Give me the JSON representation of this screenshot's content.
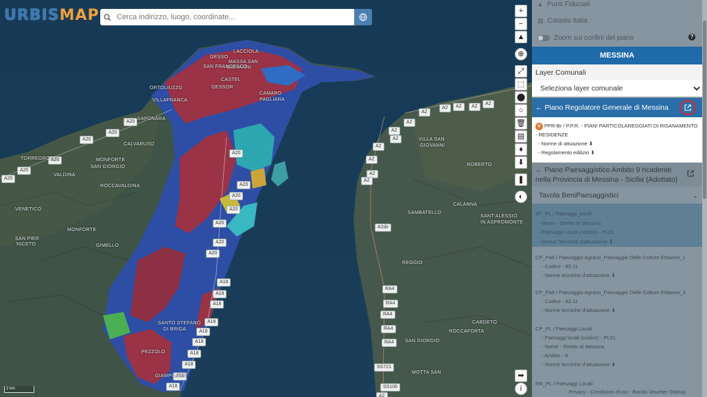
{
  "app": {
    "logo_part1": "URBIS",
    "logo_part2": "MAP"
  },
  "search": {
    "placeholder": "Cerca indirizzo, luogo, coordinate..."
  },
  "map": {
    "scale_label": "2 km",
    "road_badges": [
      {
        "label": "A20",
        "l": 180,
        "t": 172
      },
      {
        "label": "A20",
        "l": 154,
        "t": 188
      },
      {
        "label": "A20",
        "l": 116,
        "t": 198
      },
      {
        "label": "A20",
        "l": 70,
        "t": 228
      },
      {
        "label": "A20",
        "l": 25,
        "t": 243
      },
      {
        "label": "A20",
        "l": 2,
        "t": 255
      },
      {
        "label": "A20",
        "l": 334,
        "t": 218
      },
      {
        "label": "A20",
        "l": 345,
        "t": 264
      },
      {
        "label": "A20",
        "l": 334,
        "t": 280
      },
      {
        "label": "A20",
        "l": 330,
        "t": 300
      },
      {
        "label": "A20",
        "l": 310,
        "t": 320
      },
      {
        "label": "A20",
        "l": 310,
        "t": 348
      },
      {
        "label": "A20",
        "l": 300,
        "t": 364
      },
      {
        "label": "A18",
        "l": 316,
        "t": 406
      },
      {
        "label": "A18",
        "l": 310,
        "t": 423
      },
      {
        "label": "A18",
        "l": 306,
        "t": 438
      },
      {
        "label": "A18",
        "l": 298,
        "t": 464
      },
      {
        "label": "A18",
        "l": 286,
        "t": 478
      },
      {
        "label": "A18",
        "l": 280,
        "t": 493
      },
      {
        "label": "A18",
        "l": 273,
        "t": 510
      },
      {
        "label": "A18",
        "l": 265,
        "t": 526
      },
      {
        "label": "A18",
        "l": 252,
        "t": 543
      },
      {
        "label": "A18",
        "l": 242,
        "t": 558
      },
      {
        "label": "A2",
        "l": 640,
        "t": 152
      },
      {
        "label": "A2",
        "l": 660,
        "t": 150
      },
      {
        "label": "A2",
        "l": 683,
        "t": 150
      },
      {
        "label": "A2",
        "l": 703,
        "t": 146
      },
      {
        "label": "A2",
        "l": 610,
        "t": 158
      },
      {
        "label": "A2",
        "l": 588,
        "t": 173
      },
      {
        "label": "A2",
        "l": 566,
        "t": 185
      },
      {
        "label": "A2",
        "l": 568,
        "t": 197
      },
      {
        "label": "A2",
        "l": 543,
        "t": 208
      },
      {
        "label": "A2",
        "l": 533,
        "t": 227
      },
      {
        "label": "A2",
        "l": 534,
        "t": 248
      },
      {
        "label": "A2",
        "l": 526,
        "t": 258
      },
      {
        "label": "A2dir",
        "l": 546,
        "t": 326
      },
      {
        "label": "RA4",
        "l": 557,
        "t": 416
      },
      {
        "label": "RA4",
        "l": 558,
        "t": 437
      },
      {
        "label": "RA4",
        "l": 554,
        "t": 453
      },
      {
        "label": "RA4",
        "l": 555,
        "t": 474
      },
      {
        "label": "RA4",
        "l": 556,
        "t": 494
      },
      {
        "label": "SS721",
        "l": 545,
        "t": 530
      },
      {
        "label": "SS106",
        "l": 554,
        "t": 559
      },
      {
        "label": "A2",
        "l": 548,
        "t": 572
      }
    ],
    "place_labels": [
      {
        "label": "MASSA SAN",
        "l": 333,
        "t": 87
      },
      {
        "label": "GIOVANNI",
        "l": 330,
        "t": 95
      },
      {
        "label": "CASTEL",
        "l": 322,
        "t": 113
      },
      {
        "label": "LACCIOLA",
        "l": 340,
        "t": 72
      },
      {
        "label": "GESSO",
        "l": 306,
        "t": 80
      },
      {
        "label": "GESSOR",
        "l": 308,
        "t": 124
      },
      {
        "label": "CAMARO",
        "l": 378,
        "t": 133
      },
      {
        "label": "PAGLIARA",
        "l": 378,
        "t": 142
      },
      {
        "label": "SAN FRANCESCO",
        "l": 296,
        "t": 94
      },
      {
        "label": "ORTOLIUZZO",
        "l": 218,
        "t": 125
      },
      {
        "label": "VILLAFRANCA",
        "l": 222,
        "t": 143
      },
      {
        "label": "SAPONARA",
        "l": 200,
        "t": 170
      },
      {
        "label": "CALVARUSO",
        "l": 180,
        "t": 207
      },
      {
        "label": "MONFORTE",
        "l": 140,
        "t": 230
      },
      {
        "label": "SAN GIORGIO",
        "l": 132,
        "t": 240
      },
      {
        "label": "ROCCAVALDINA",
        "l": 146,
        "t": 268
      },
      {
        "label": "TORREGROTTA",
        "l": 30,
        "t": 228
      },
      {
        "label": "VALDINA",
        "l": 78,
        "t": 252
      },
      {
        "label": "VENETICO",
        "l": 22,
        "t": 302
      },
      {
        "label": "SAN PIER",
        "l": 22,
        "t": 345
      },
      {
        "label": "NICETO",
        "l": 24,
        "t": 353
      },
      {
        "label": "MONFORTE",
        "l": 98,
        "t": 332
      },
      {
        "label": "GIMELLO",
        "l": 140,
        "t": 355
      },
      {
        "label": "SANTO STEFANO",
        "l": 230,
        "t": 468
      },
      {
        "label": "DI BRIGA",
        "l": 238,
        "t": 477
      },
      {
        "label": "PEZZOLO",
        "l": 206,
        "t": 510
      },
      {
        "label": "GIAMPILIERI",
        "l": 226,
        "t": 545
      },
      {
        "label": "VILLA SAN",
        "l": 610,
        "t": 200
      },
      {
        "label": "GIOVANNI",
        "l": 612,
        "t": 209
      },
      {
        "label": "ROBERTO",
        "l": 680,
        "t": 237
      },
      {
        "label": "SAMBATELLO",
        "l": 594,
        "t": 307
      },
      {
        "label": "SANT'ALESSIO",
        "l": 700,
        "t": 312
      },
      {
        "label": "IN ASPROMONTE",
        "l": 700,
        "t": 321
      },
      {
        "label": "CALANNA",
        "l": 660,
        "t": 295
      },
      {
        "label": "REGGIO",
        "l": 586,
        "t": 380
      },
      {
        "label": "CARDETO",
        "l": 688,
        "t": 467
      },
      {
        "label": "SAN GIORGIO",
        "l": 590,
        "t": 494
      },
      {
        "label": "ROCCAFORTA",
        "l": 654,
        "t": 480
      },
      {
        "label": "MOTTA SAN",
        "l": 600,
        "t": 540
      }
    ]
  },
  "controls": [
    {
      "name": "zoom-in-button",
      "glyph": "+",
      "t": 7
    },
    {
      "name": "zoom-out-button",
      "glyph": "−",
      "t": 26
    },
    {
      "name": "compass-button",
      "glyph": "▲",
      "t": 45
    },
    {
      "name": "locate-button",
      "glyph": "⊕",
      "t": 70
    },
    {
      "name": "measure-line-button",
      "glyph": "⤢",
      "t": 95
    },
    {
      "name": "select-area-button",
      "glyph": "⬚",
      "t": 114
    },
    {
      "name": "place-marker-button",
      "glyph": "⬤",
      "t": 133
    },
    {
      "name": "draw-circle-button",
      "glyph": "○",
      "t": 152
    },
    {
      "name": "delete-button",
      "glyph": "🗑",
      "t": 171
    },
    {
      "name": "print-button",
      "glyph": "▤",
      "t": 190
    },
    {
      "name": "pin-button",
      "glyph": "♦",
      "t": 209
    },
    {
      "name": "download-button",
      "glyph": "⬇",
      "t": 228
    },
    {
      "name": "bookmark-button",
      "glyph": "❚",
      "t": 253
    },
    {
      "name": "layers-button",
      "glyph": "◐",
      "t": 278
    },
    {
      "name": "collapse-panel-button",
      "glyph": "➡",
      "t": 539
    },
    {
      "name": "info-button",
      "glyph": "i",
      "t": 558
    }
  ],
  "panel": {
    "punti_fiduciali": "Punti Fiduciali",
    "catasto_italia": "Catasto Italia",
    "zoom_confini": "Zoom sui confini del piano",
    "help_glyph": "?",
    "comune_title": "MESSINA",
    "layer_comunali_label": "Layer Comunali",
    "select_layer": {
      "value": "Seleziona layer comunale",
      "options": [
        "Seleziona layer comunale"
      ]
    },
    "prg_title": "Piano Regolatore Generale di Messina",
    "prg_badge": "V",
    "prg_text": "PPR-Br / P.P.R. - PIANI PARTICOLAREGGIATI DI RISANAMENTO - RESIDENZE",
    "prg_norme": "- Norme di attuazione",
    "prg_regolamento": "- Regolamento edilizio",
    "ppa_title": "Piano Paesaggistico Ambito 9 ricadente nella Provincia di Messina - Sicilia (Adottato)",
    "tavola_title": "Tavola BeniPaesaggistici",
    "highlight": {
      "title": "BP_PL / Paesaggi_locali",
      "lines": [
        "- Nome - Stretto di Messina",
        "- Paesaggi Locali (codice) - PL01",
        "- Norme Tecniche d'attuazione"
      ]
    },
    "group1": {
      "title": "CP_Pa5 / Paesaggio Agrario_Paesaggio Delle Colture Erbacee_1",
      "lines": [
        "- Codice - 83.11",
        "- Norme tecniche d'attuazione"
      ]
    },
    "group2": {
      "title": "CP_Pa6 / Paesaggio Agrario_Paesaggio Delle Colture Erbacee_2",
      "lines": [
        "- Codice - 83.11",
        "- Norme tecniche d'attuazione"
      ]
    },
    "group3": {
      "title": "CP_PL / Paesaggi Locali",
      "lines": [
        "- Paesaggi locali (codice) - PL01",
        "- Nome - Stretto di Messina",
        "- Ambito - 9",
        "- Norme tecniche d'attuazione"
      ]
    },
    "group4_title": "RN_PL / Paesaggi Locali",
    "footer": "Privacy - Condizioni d'uso - Bando Voucher Startup"
  }
}
